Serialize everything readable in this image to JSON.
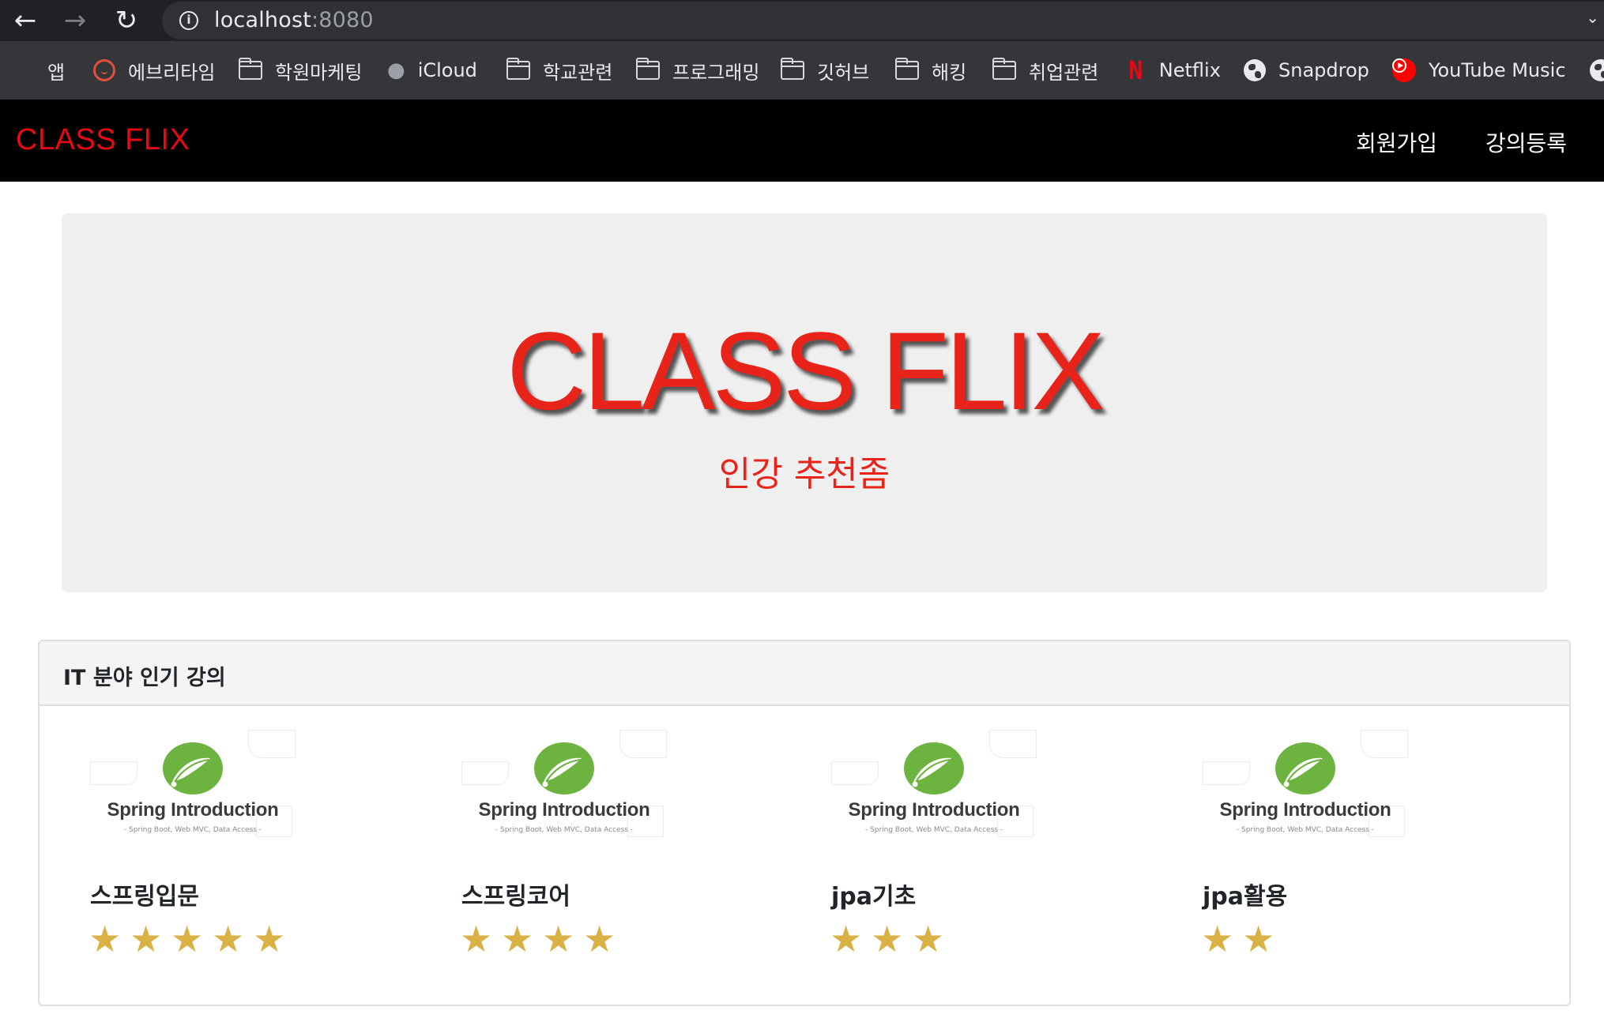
{
  "browser": {
    "url_host": "localhost",
    "url_port": ":8080",
    "bookmarks": [
      {
        "label": "앱",
        "icon": "apps-grid-icon"
      },
      {
        "label": "에브리타임",
        "icon": "everytime-alarm-icon"
      },
      {
        "label": "학원마케팅",
        "icon": "folder-icon"
      },
      {
        "label": "iCloud",
        "icon": "apple-icon"
      },
      {
        "label": "학교관련",
        "icon": "folder-icon"
      },
      {
        "label": "프로그래밍",
        "icon": "folder-icon"
      },
      {
        "label": "깃허브",
        "icon": "folder-icon"
      },
      {
        "label": "해킹",
        "icon": "folder-icon"
      },
      {
        "label": "취업관련",
        "icon": "folder-icon"
      },
      {
        "label": "Netflix",
        "icon": "netflix-icon"
      },
      {
        "label": "Snapdrop",
        "icon": "globe-icon"
      },
      {
        "label": "YouTube Music",
        "icon": "youtube-music-icon"
      }
    ]
  },
  "navbar": {
    "brand": "CLASS FLIX",
    "links": [
      "회원가입",
      "강의등록"
    ]
  },
  "hero": {
    "title": "CLASS FLIX",
    "subtitle": "인강 추천좀"
  },
  "popular": {
    "heading": "IT 분야 인기 강의",
    "courses": [
      {
        "thumb_title": "Spring Introduction",
        "thumb_sub": "- Spring Boot, Web MVC, Data Access -",
        "name": "스프링입문",
        "rating": 5
      },
      {
        "thumb_title": "Spring Introduction",
        "thumb_sub": "- Spring Boot, Web MVC, Data Access -",
        "name": "스프링코어",
        "rating": 4
      },
      {
        "thumb_title": "Spring Introduction",
        "thumb_sub": "- Spring Boot, Web MVC, Data Access -",
        "name": "jpa기초",
        "rating": 3
      },
      {
        "thumb_title": "Spring Introduction",
        "thumb_sub": "- Spring Boot, Web MVC, Data Access -",
        "name": "jpa활용",
        "rating": 2
      }
    ]
  },
  "colors": {
    "brand_red": "#e50914",
    "star_gold": "#d9b144",
    "spring_green": "#6db33f"
  }
}
